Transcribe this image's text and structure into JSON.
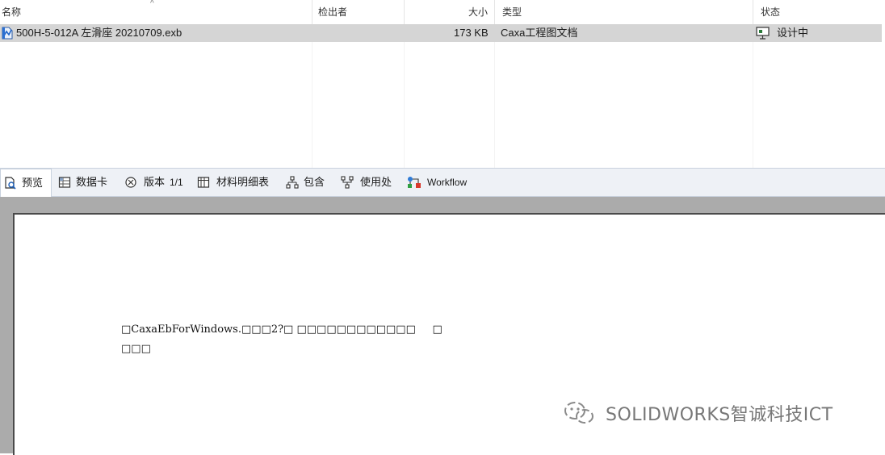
{
  "file_list": {
    "columns": {
      "name": "名称",
      "checked_out_by": "检出者",
      "size": "大小",
      "type": "类型",
      "state": "状态"
    },
    "rows": [
      {
        "name": "500H-5-012A 左滑座 20210709.exb",
        "checked_out_by": "",
        "size": "173 KB",
        "type": "Caxa工程图文档",
        "state": "设计中",
        "file_icon": "exb-file-icon",
        "state_icon": "workflow-state-icon"
      }
    ]
  },
  "tabs": [
    {
      "label": "预览",
      "icon": "preview-icon",
      "active": true
    },
    {
      "label": "数据卡",
      "icon": "data-card-icon"
    },
    {
      "label": "版本",
      "icon": "version-icon",
      "suffix": "1/1"
    },
    {
      "label": "材料明细表",
      "icon": "bom-icon"
    },
    {
      "label": "包含",
      "icon": "contains-icon"
    },
    {
      "label": "使用处",
      "icon": "where-used-icon"
    },
    {
      "label": "Workflow",
      "icon": "workflow-icon"
    }
  ],
  "preview": {
    "line1": "□CaxaEbForWindows.□□□2?□ □□□□□□□□□□□□     □",
    "line2": "□□□"
  },
  "watermark": {
    "text": "SOLIDWORKS智诚科技ICT",
    "icon": "wechat-icon"
  },
  "colors": {
    "selected_row": "#d5d5d5",
    "tabbar_bg": "#eef1f6",
    "preview_bg": "#ababab"
  }
}
